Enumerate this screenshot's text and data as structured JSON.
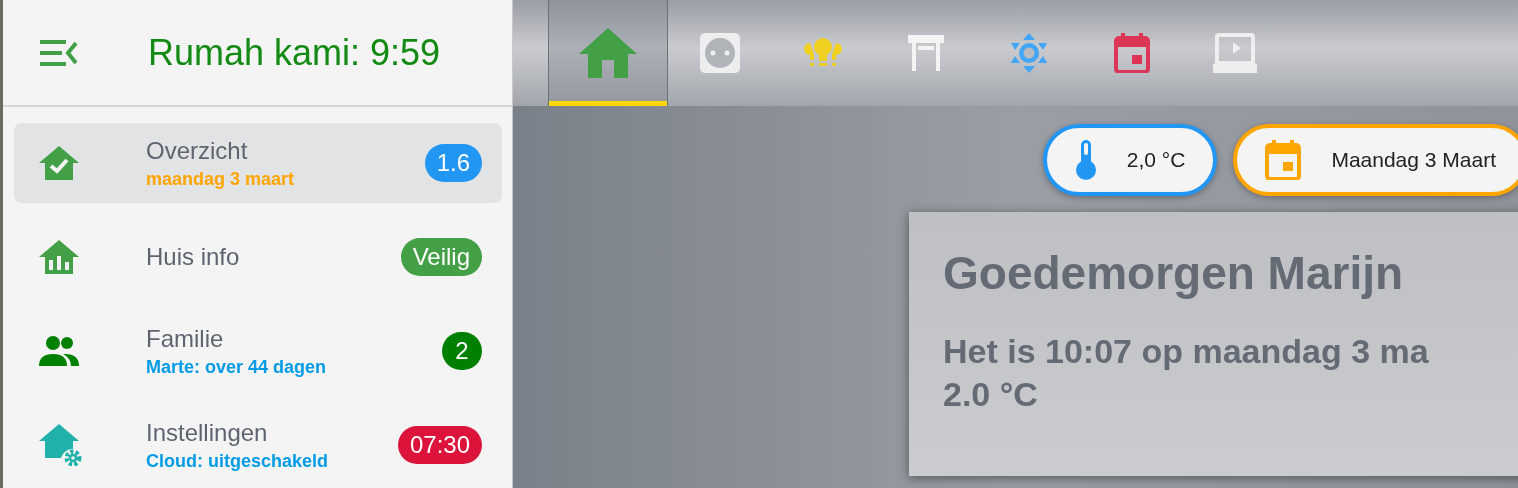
{
  "sidebar": {
    "title": "Rumah kami: 9:59",
    "items": [
      {
        "kind": "home-check",
        "label": "Overzicht",
        "selected": true,
        "subtitle": {
          "text": "maandag 3 maart",
          "color": "#ffa500"
        },
        "badge": {
          "text": "1.6",
          "color": "#2196f3"
        }
      },
      {
        "kind": "home-chart",
        "label": "Huis info",
        "selected": false,
        "badge": {
          "text": "Veilig",
          "color": "#43a047"
        }
      },
      {
        "kind": "people",
        "label": "Familie",
        "selected": false,
        "subtitle": {
          "text": "Marte: over 44 dagen",
          "color": "#039be5"
        },
        "badge": {
          "text": "2",
          "color": "#008000"
        }
      },
      {
        "kind": "home-gear",
        "label": "Instellingen",
        "selected": false,
        "subtitle": {
          "text": "Cloud: uitgeschakeld",
          "color": "#039be5"
        },
        "badge": {
          "text": "07:30",
          "color": "#dc143c"
        }
      }
    ]
  },
  "tabs": [
    {
      "kind": "home",
      "selected": true
    },
    {
      "kind": "socket",
      "selected": false
    },
    {
      "kind": "bulbs",
      "selected": false
    },
    {
      "kind": "gate",
      "selected": false
    },
    {
      "kind": "brightness",
      "selected": false
    },
    {
      "kind": "calendar",
      "selected": false
    },
    {
      "kind": "theater",
      "selected": false
    }
  ],
  "chips": [
    {
      "kind": "thermometer",
      "text": "2,0 °C",
      "color": "#2196f3"
    },
    {
      "kind": "calendar",
      "text": "Maandag 3 Maart",
      "color": "#ffa500"
    }
  ],
  "card": {
    "title": "Goedemorgen Marijn",
    "lines": [
      "Het is 10:07 op maandag 3 ma",
      "2.0 °C"
    ]
  }
}
